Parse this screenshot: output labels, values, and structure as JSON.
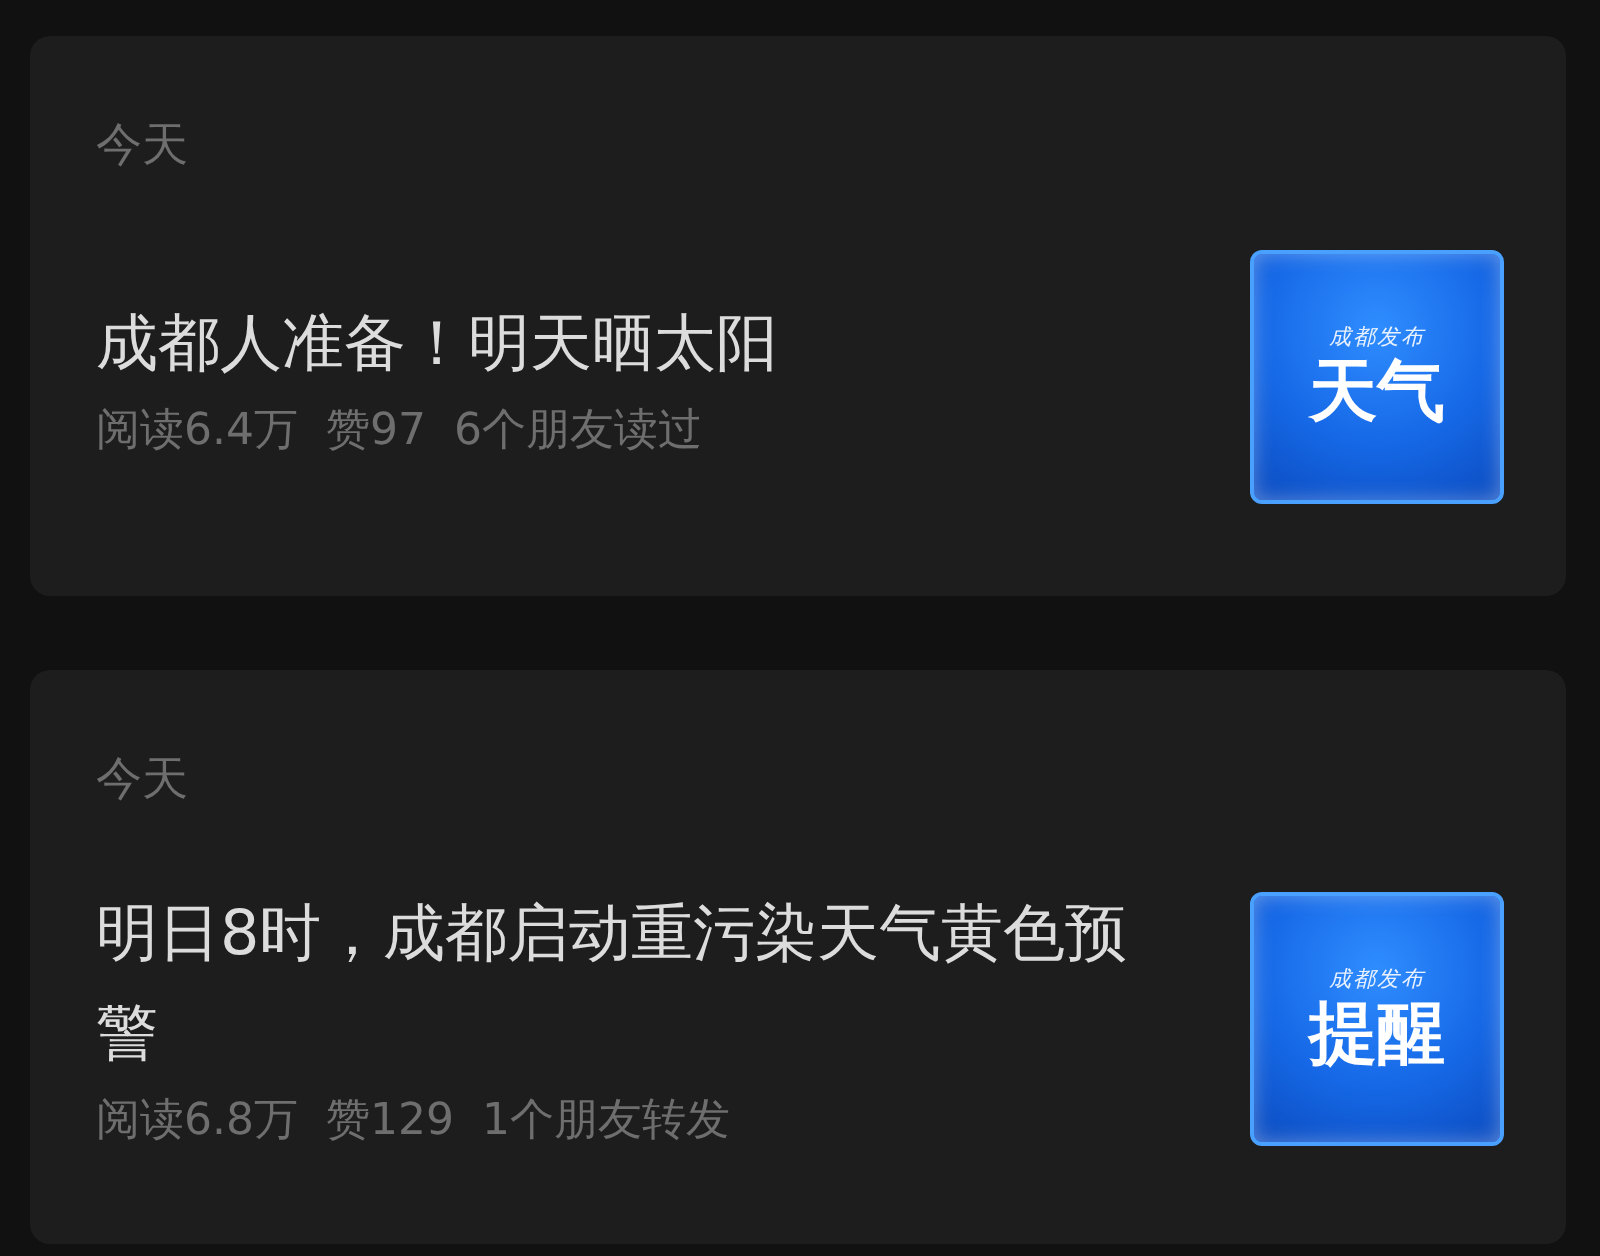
{
  "articles": [
    {
      "date": "今天",
      "title": "成都人准备！明天晒太阳",
      "stats": {
        "reads": "阅读6.4万",
        "likes": "赞97",
        "friends": "6个朋友读过"
      },
      "thumbnail": {
        "brand": "成都发布",
        "label": "天气"
      }
    },
    {
      "date": "今天",
      "title": "明日8时，成都启动重污染天气黄色预警",
      "stats": {
        "reads": "阅读6.8万",
        "likes": "赞129",
        "friends": "1个朋友转发"
      },
      "thumbnail": {
        "brand": "成都发布",
        "label": "提醒"
      }
    }
  ]
}
